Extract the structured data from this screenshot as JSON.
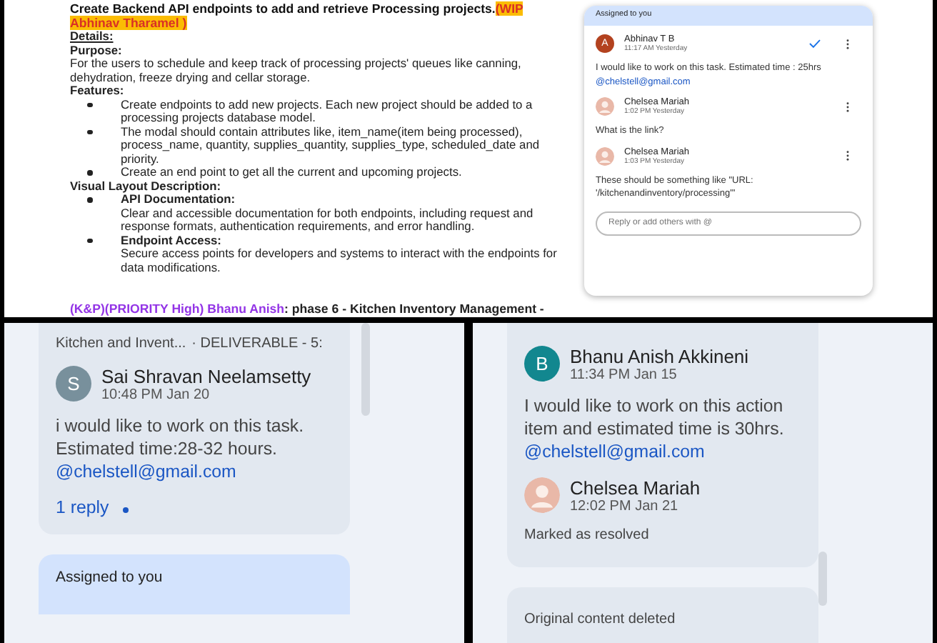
{
  "document": {
    "title": "Create Backend API endpoints to add and retrieve Processing projects.",
    "title_tag": "(WIP Abhinav Tharamel )",
    "blocks": [
      {
        "kind": "underline_heading",
        "text": "Details:"
      },
      {
        "kind": "heading",
        "text": "Purpose:"
      },
      {
        "kind": "paragraph",
        "text": "For the users to schedule and keep track of processing projects' queues like canning, dehydration, freeze drying and cellar storage."
      },
      {
        "kind": "heading",
        "text": "Features:"
      },
      {
        "kind": "bullet",
        "text": "Create endpoints to add new projects. Each new project should be added to a processing projects database model."
      },
      {
        "kind": "bullet",
        "text": "The modal should contain attributes like, item_name(item being processed), process_name, quantity, supplies_quantity, supplies_type, scheduled_date and priority."
      },
      {
        "kind": "bullet",
        "text": " Create an end point to get all the current and upcoming projects."
      },
      {
        "kind": "heading",
        "text": "Visual Layout Description:"
      },
      {
        "kind": "bullet",
        "title": "API Documentation:",
        "text": "Clear and accessible documentation for both endpoints, including request and response formats, authentication requirements, and error handling."
      },
      {
        "kind": "bullet",
        "title": "Endpoint Access:",
        "text": "Secure access points for developers and systems to interact with the endpoints for data modifications."
      }
    ],
    "next_task": {
      "tag": "(K&P)(PRIORITY High) Bhanu Anish",
      "text": ": phase 6 - Kitchen Inventory Management -"
    }
  },
  "comment_card": {
    "header": "Assigned to you",
    "comments": [
      {
        "author": "Abhinav T B",
        "time": "11:17 AM Yesterday",
        "avatar": {
          "kind": "letter",
          "letter": "A",
          "color": "#b3421f"
        },
        "resolve_button": true,
        "body": "I would like to work on this task. Estimated time : 25hrs",
        "mention": "@chelstell@gmail.com"
      },
      {
        "author": "Chelsea Mariah",
        "time": "1:02 PM Yesterday",
        "avatar": {
          "kind": "photo"
        },
        "resolve_button": false,
        "body": "What is the link?"
      },
      {
        "author": "Chelsea Mariah",
        "time": "1:03 PM Yesterday",
        "avatar": {
          "kind": "photo"
        },
        "resolve_button": false,
        "body": "These should be something like \"URL: '/kitchenandinventory/processing'\""
      }
    ],
    "reply": {
      "placeholder": "Reply or add others with @"
    }
  },
  "left_thread": {
    "context": "Kitchen and Invent...",
    "context_tag": "· DELIVERABLE - 5:",
    "comments": [
      {
        "author": "Sai Shravan Neelamsetty",
        "time": "10:48 PM Jan 20",
        "avatar": {
          "kind": "letter",
          "letter": "S",
          "color": "#78909c"
        },
        "body": "i would like to work on this task. Estimated time:28-32 hours.",
        "mention": "@chelstell@gmail.com"
      }
    ],
    "replies": "1 reply",
    "unread": true,
    "next_header": "Assigned to you"
  },
  "right_thread": {
    "comments": [
      {
        "author": "Bhanu Anish Akkineni",
        "time": "11:34 PM Jan 15",
        "avatar": {
          "kind": "letter",
          "letter": "B",
          "color": "#12878f"
        },
        "body": "I would like to work on this action item and estimated time is 30hrs.",
        "mention": "@chelstell@gmail.com"
      },
      {
        "author": "Chelsea Mariah",
        "time": "12:02 PM Jan 21",
        "avatar": {
          "kind": "photo"
        },
        "status": "Marked as resolved"
      }
    ],
    "next_card": "Original content deleted"
  }
}
